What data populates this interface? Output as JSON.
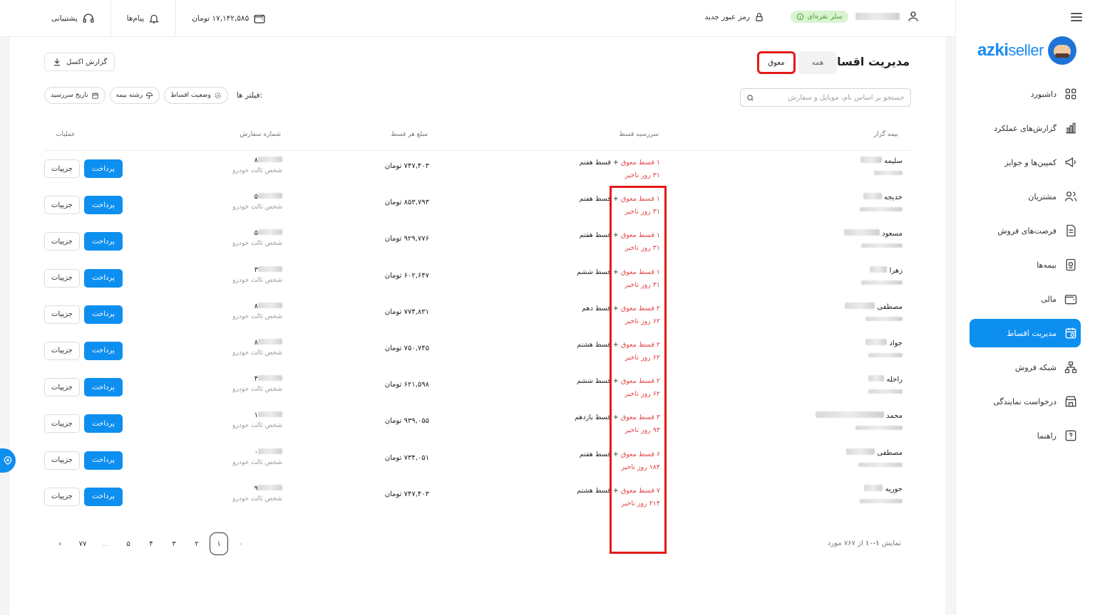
{
  "sidebar": {
    "logo": {
      "brand_bold": "azki",
      "brand_light": "seller"
    },
    "items": [
      {
        "label": "داشبورد",
        "icon": "grid-icon"
      },
      {
        "label": "گزارش‌های عملکرد",
        "icon": "bar-chart-icon"
      },
      {
        "label": "کمپین‌ها و جوایز",
        "icon": "megaphone-icon"
      },
      {
        "label": "مشتریان",
        "icon": "users-icon"
      },
      {
        "label": "فرصت‌های فروش",
        "icon": "document-icon"
      },
      {
        "label": "بیمه‌ها",
        "icon": "policy-icon"
      },
      {
        "label": "مالی",
        "icon": "wallet-icon"
      },
      {
        "label": "مدیریت اقساط",
        "icon": "calendar-icon",
        "active": true
      },
      {
        "label": "شبکه فروش",
        "icon": "network-icon"
      },
      {
        "label": "درخواست نمایندگی",
        "icon": "store-icon"
      },
      {
        "label": "راهنما",
        "icon": "help-icon"
      }
    ]
  },
  "header": {
    "tier_badge": "سلر نقره‌ای",
    "new_password": "رمز عبور جدید",
    "wallet_balance": "۱۷,۱۴۲,۵۸۵ تومان",
    "messages": "پیام‌ها",
    "support": "پشتیبانی"
  },
  "page": {
    "title": "مدیریت اقساط",
    "tabs": [
      {
        "label": "همه"
      },
      {
        "label": "معوق",
        "active": true
      }
    ],
    "excel_label": "گزارش اکسل",
    "search_placeholder": "جستجو بر اساس نام، موبایل و سفارش",
    "filters_label": "فیلتر ها:",
    "filters": [
      "وضعیت اقساط",
      "رشته بیمه",
      "تاریخ سررسید"
    ]
  },
  "table": {
    "headers": {
      "name": "بیمه گزار",
      "due": "سررسید قسط",
      "amount": "مبلغ هر قسط",
      "order": "شماره سفارش",
      "ops": "عملیات"
    },
    "pay_label": "پرداخت",
    "detail_label": "جزییات",
    "rows": [
      {
        "name": "سلیمه",
        "due": "قسط هفتم",
        "overdue": "۱ قسط معوق",
        "late": "۳۱ روز تاخیر",
        "amount": "۷۴۷,۴۰۳ تومان",
        "order_tail": "۸",
        "insurance": "شخص ثالث خودرو"
      },
      {
        "name": "خدیجه",
        "due": "قسط هفتم",
        "overdue": "۱ قسط معوق",
        "late": "۳۱ روز تاخیر",
        "amount": "۸۵۳,۷۹۳ تومان",
        "order_tail": "۵",
        "insurance": "شخص ثالث خودرو"
      },
      {
        "name": "مسعود",
        "due": "قسط هفتم",
        "overdue": "۱ قسط معوق",
        "late": "۳۱ روز تاخیر",
        "amount": "۹۲۹,۷۷۶ تومان",
        "order_tail": "۵",
        "insurance": "شخص ثالث خودرو"
      },
      {
        "name": "زهرا",
        "due": "قسط ششم",
        "overdue": "۱ قسط معوق",
        "late": "۳۱ روز تاخیر",
        "amount": "۶۰۲,۶۴۷ تومان",
        "order_tail": "۳",
        "insurance": "شخص ثالث خودرو"
      },
      {
        "name": "مصطفی",
        "due": "قسط دهم",
        "overdue": "۲ قسط معوق",
        "late": "۶۲ روز تاخیر",
        "amount": "۷۷۴,۸۳۱ تومان",
        "order_tail": "۸",
        "insurance": "شخص ثالث خودرو"
      },
      {
        "name": "جواد",
        "due": "قسط هشتم",
        "overdue": "۲ قسط معوق",
        "late": "۶۲ روز تاخیر",
        "amount": "۷۵۰,۷۴۵ تومان",
        "order_tail": "۸",
        "insurance": "شخص ثالث خودرو"
      },
      {
        "name": "راحله",
        "due": "قسط ششم",
        "overdue": "۲ قسط معوق",
        "late": "۶۲ روز تاخیر",
        "amount": "۶۲۱,۵۹۸ تومان",
        "order_tail": "۴",
        "insurance": "شخص ثالث خودرو"
      },
      {
        "name": "محمد",
        "due": "قسط یازدهم",
        "overdue": "۳ قسط معوق",
        "late": "۹۳ روز تاخیر",
        "amount": "۹۳۹,۰۵۵ تومان",
        "order_tail": "۱",
        "insurance": "شخص ثالث خودرو"
      },
      {
        "name": "مصطفی",
        "due": "قسط هفتم",
        "overdue": "۶ قسط معوق",
        "late": "۱۸۴ روز تاخیر",
        "amount": "۷۳۴,۰۵۱ تومان",
        "order_tail": "۰",
        "insurance": "شخص ثالث خودرو"
      },
      {
        "name": "حوریه",
        "due": "قسط هشتم",
        "overdue": "۷ قسط معوق",
        "late": "۲۱۴ روز تاخیر",
        "amount": "۷۴۷,۴۰۳ تومان",
        "order_tail": "۹",
        "insurance": "شخص ثالث خودرو"
      }
    ]
  },
  "pagination": {
    "summary_prefix": "نمایش",
    "summary_range": "۱-۱۰",
    "summary_mid": "از",
    "summary_total": "۷۶۷ مورد",
    "pages": [
      "۱",
      "۲",
      "۳",
      "۴",
      "۵",
      "...",
      "۷۷"
    ],
    "current": "۱"
  },
  "colors": {
    "accent": "#0d8ff0",
    "overdue": "#e14545",
    "highlight": "#e41a1a",
    "badge_bg": "#d9f3d0",
    "badge_fg": "#49a53a"
  }
}
